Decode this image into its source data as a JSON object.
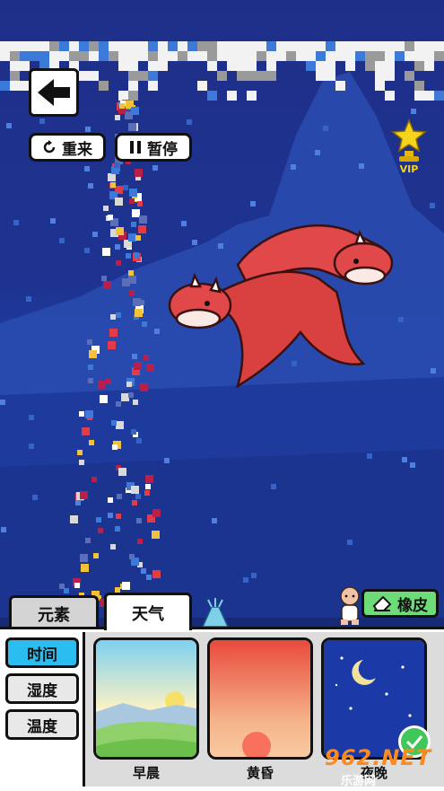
{
  "toolbar": {
    "back_icon": "arrow-left-icon",
    "restart_label": "重来",
    "pause_label": "暂停"
  },
  "vip": {
    "label": "VIP",
    "icon": "trophy-star-icon"
  },
  "tabs": [
    {
      "label": "元素",
      "active": false
    },
    {
      "label": "天气",
      "active": true
    }
  ],
  "eraser": {
    "label": "橡皮",
    "icon": "eraser-icon"
  },
  "sidebar": [
    {
      "label": "时间",
      "active": true
    },
    {
      "label": "湿度",
      "active": false
    },
    {
      "label": "温度",
      "active": false
    }
  ],
  "cards": [
    {
      "label": "早晨",
      "selected": false
    },
    {
      "label": "黄昏",
      "selected": false
    },
    {
      "label": "夜晚",
      "selected": true
    }
  ],
  "watermark": {
    "text": "962.NET",
    "sub": "乐游网"
  },
  "colors": {
    "sky": "#1e3391",
    "tab_active": "#ffffff",
    "side_active": "#29bdf0",
    "eraser": "#6ddb78",
    "dragon": "#e0484a"
  }
}
